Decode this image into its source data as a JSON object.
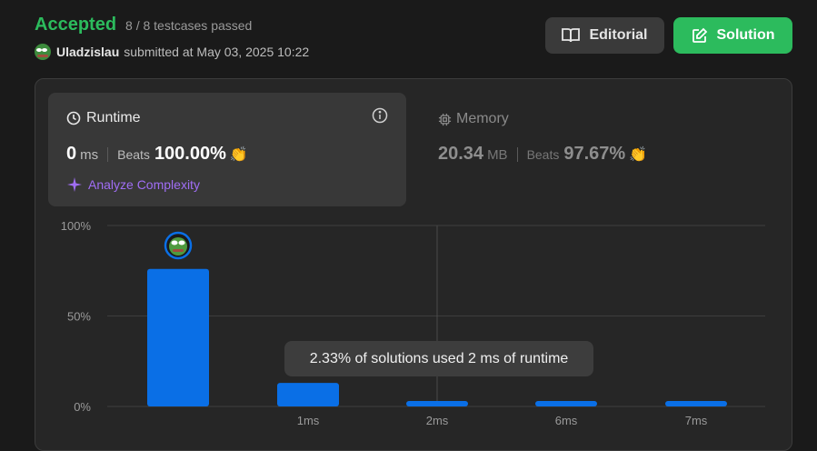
{
  "header": {
    "status": "Accepted",
    "testcases": "8 / 8 testcases passed",
    "username": "Uladzislau",
    "submitted": "submitted at May 03, 2025 10:22"
  },
  "buttons": {
    "editorial": "Editorial",
    "solution": "Solution"
  },
  "runtime": {
    "title": "Runtime",
    "value": "0",
    "unit": "ms",
    "beats_label": "Beats",
    "beats": "100.00%",
    "analyze": "Analyze Complexity"
  },
  "memory": {
    "title": "Memory",
    "value": "20.34",
    "unit": "MB",
    "beats_label": "Beats",
    "beats": "97.67%"
  },
  "tooltip": "2.33% of solutions used 2 ms of runtime",
  "colors": {
    "accent_green": "#2cbb5d",
    "bar_blue": "#0a6fe6",
    "purple": "#a06ef5"
  },
  "chart_data": {
    "type": "bar",
    "categories": [
      "",
      "1ms",
      "2ms",
      "6ms",
      "7ms"
    ],
    "values": [
      76,
      13,
      2.33,
      2.33,
      2.33
    ],
    "ylim": [
      0,
      100
    ],
    "yticks": [
      "0%",
      "50%",
      "100%"
    ],
    "ytick_values": [
      0,
      50,
      100
    ],
    "grid": true
  }
}
